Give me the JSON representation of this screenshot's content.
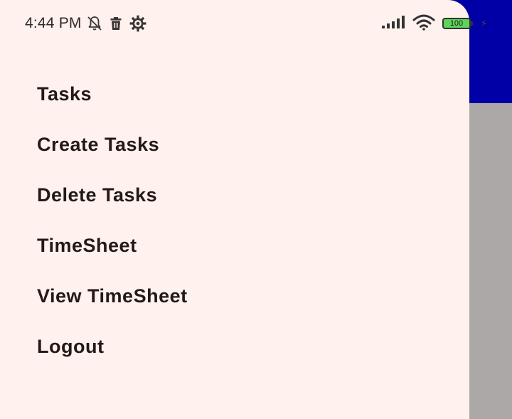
{
  "status_bar": {
    "time": "4:44 PM",
    "left_icons": [
      "notifications-off-icon",
      "trash-icon",
      "settings-icon"
    ],
    "right_icons": [
      "signal-icon",
      "wifi-icon",
      "battery-icon",
      "charging-icon"
    ],
    "battery_level": "100"
  },
  "colors": {
    "app_bar": "#0000a6",
    "scrim": "#aca8a8",
    "drawer_background": "#fff1ee",
    "menu_text": "#231a17",
    "battery_fill": "#5fd35a"
  },
  "drawer": {
    "items": [
      {
        "label": "Tasks"
      },
      {
        "label": "Create Tasks"
      },
      {
        "label": "Delete Tasks"
      },
      {
        "label": "TimeSheet"
      },
      {
        "label": "View TimeSheet"
      },
      {
        "label": "Logout"
      }
    ]
  }
}
